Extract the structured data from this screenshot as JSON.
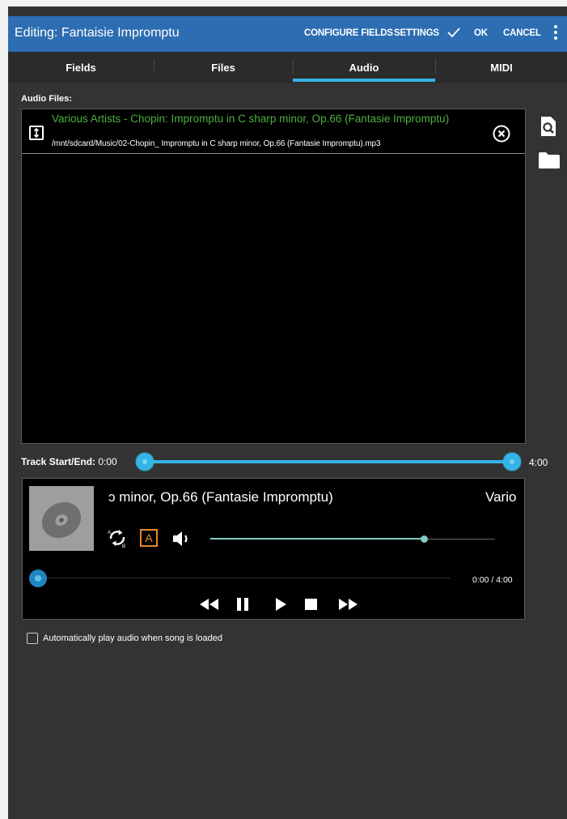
{
  "actionbar": {
    "title": "Editing: Fantaisie Impromptu",
    "configure_fields": "CONFIGURE FIELDS",
    "settings": "SETTINGS",
    "ok": "OK",
    "cancel": "CANCEL"
  },
  "tabs": [
    {
      "label": "Fields",
      "selected": false
    },
    {
      "label": "Files",
      "selected": false
    },
    {
      "label": "Audio",
      "selected": true
    },
    {
      "label": "MIDI",
      "selected": false
    }
  ],
  "audio_files": {
    "label": "Audio Files:",
    "items": [
      {
        "title": "Various Artists -  Chopin: Impromptu in C sharp minor, Op.66 (Fantasie Impromptu)",
        "path": "/mnt/sdcard/Music/02-Chopin_ Impromptu in C sharp minor, Op.66 (Fantasie Impromptu).mp3"
      }
    ]
  },
  "track": {
    "label": "Track Start/End:",
    "start": "0:00",
    "end": "4:00"
  },
  "player": {
    "title_visible": "ɔ minor, Op.66 (Fantasie Impromptu)",
    "artist_visible": "Vario",
    "ab_repeat_label": "A",
    "volume_fraction": 0.75,
    "position_fraction": 0.0,
    "time": "0:00 / 4:00"
  },
  "autoplay": {
    "label": "Automatically play audio when song is loaded",
    "checked": false
  },
  "colors": {
    "actionbar": "#2d6db2",
    "tab_indicator": "#33b5e5",
    "file_title": "#4caf3f",
    "ab_repeat": "#e8862a",
    "volume": "#80cbc4"
  },
  "icons": {
    "check": "check-icon",
    "overflow": "more-vert-icon",
    "drag": "drag-handle-icon",
    "remove": "close-circle-icon",
    "search_file": "file-search-icon",
    "folder": "folder-icon",
    "album": "disc-icon",
    "repeat": "repeat-icon",
    "volume": "volume-icon",
    "rewind": "rewind-icon",
    "pause": "pause-icon",
    "play": "play-icon",
    "stop": "stop-icon",
    "fast_forward": "fast-forward-icon"
  }
}
